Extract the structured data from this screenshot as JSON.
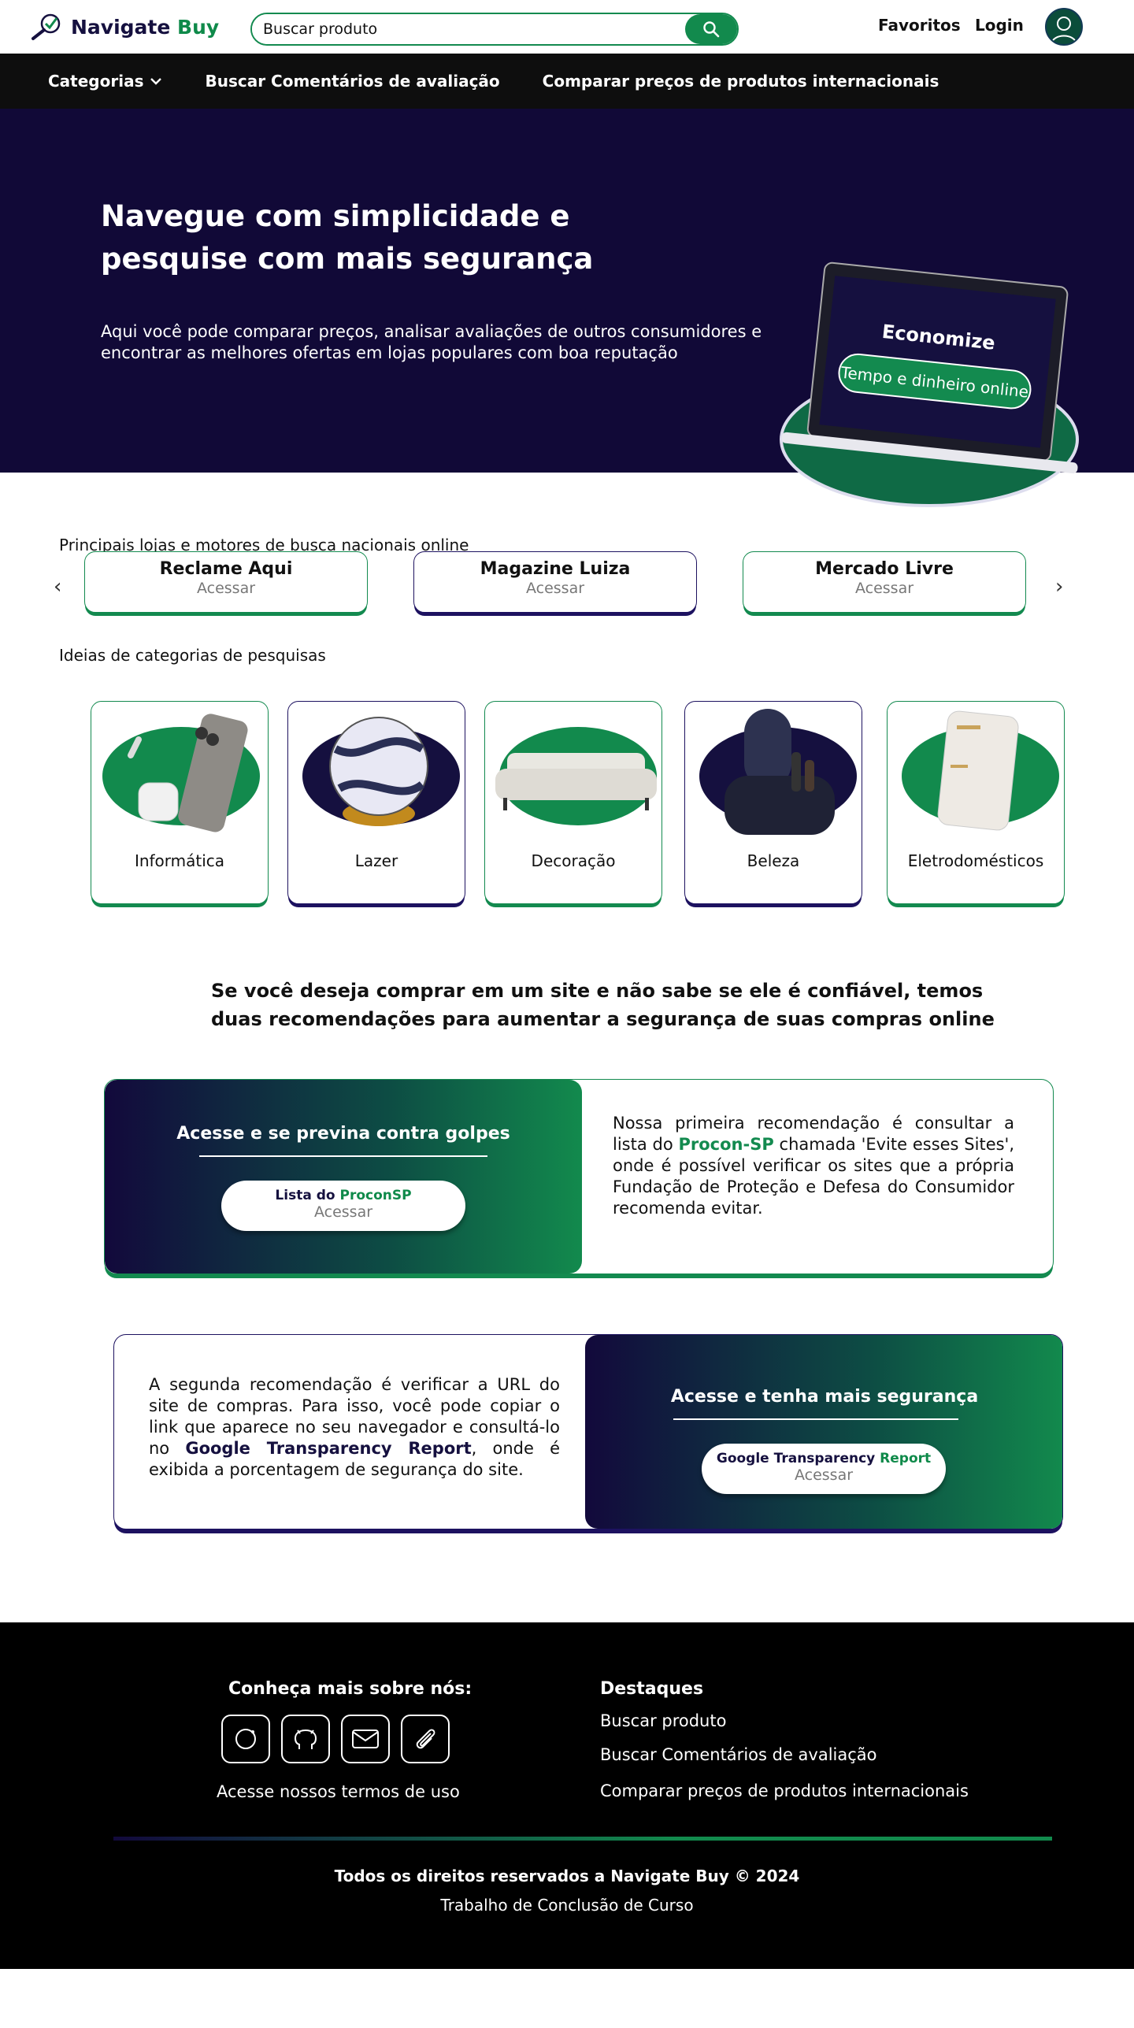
{
  "header": {
    "brand_a": "Navigate ",
    "brand_b": "Buy",
    "search_placeholder": "Buscar produto",
    "favorites": "Favoritos",
    "login": "Login"
  },
  "nav": {
    "categories": "Categorias",
    "reviews": "Buscar Comentários de avaliação",
    "compare": "Comparar preços de produtos internacionais"
  },
  "hero": {
    "title": "Navegue com simplicidade e pesquise com mais segurança",
    "subtitle": "Aqui você pode comparar preços, analisar avaliações de outros consumidores e encontrar as melhores ofertas em lojas populares com boa reputação",
    "screen_title": "Economize",
    "screen_badge": "Tempo e dinheiro online"
  },
  "stores": {
    "title": "Principais lojas e motores de busca nacionais online",
    "items": [
      {
        "name": "Reclame Aqui",
        "action": "Acessar"
      },
      {
        "name": "Magazine Luiza",
        "action": "Acessar"
      },
      {
        "name": "Mercado Livre",
        "action": "Acessar"
      }
    ]
  },
  "categories": {
    "title": "Ideias de categorias de pesquisas",
    "items": [
      {
        "label": "Informática"
      },
      {
        "label": "Lazer"
      },
      {
        "label": "Decoração"
      },
      {
        "label": "Beleza"
      },
      {
        "label": "Eletrodomésticos"
      }
    ]
  },
  "recommend": {
    "title": "Se você deseja comprar em um site e não sabe se ele é confiável, temos duas recomendações para aumentar a segurança de suas compras online",
    "card1": {
      "heading": "Acesse e se previna contra golpes",
      "btn_a": "Lista do ",
      "btn_b": "ProconSP",
      "btn_action": "Acessar",
      "text_a": "Nossa primeira recomendação é consultar a lista do ",
      "text_hl": "Procon-SP",
      "text_b": " chamada 'Evite esses Sites', onde é possível verificar os sites que a própria Fundação de Proteção e Defesa do Consumidor recomenda evitar."
    },
    "card2": {
      "heading": "Acesse e tenha mais segurança",
      "btn_a": "Google Transparency ",
      "btn_b": "Report",
      "btn_action": "Acessar",
      "text_a": "A segunda recomendação é verificar a URL do site de compras. Para isso, você pode copiar o link que aparece no seu navegador e consultá-lo no ",
      "text_hl": "Google Transparency Report",
      "text_b": ", onde é exibida a porcentagem de segurança do site."
    }
  },
  "footer": {
    "about_title": "Conheça mais sobre nós:",
    "terms": "Acesse nossos termos de uso",
    "highlights_title": "Destaques",
    "highlights": [
      "Buscar produto",
      "Buscar Comentários de avaliação",
      "Comparar preços de produtos internacionais"
    ],
    "rights": "Todos os direitos reservados a Navigate Buy © 2024",
    "tcc": "Trabalho de Conclusão de Curso"
  },
  "colors": {
    "green": "#128a4d",
    "navy": "#110937",
    "black": "#0e0e0e"
  },
  "icons": [
    "logo-check-icon",
    "search-icon",
    "user-icon",
    "chevron-down-icon",
    "chevron-left-icon",
    "chevron-right-icon",
    "instagram-icon",
    "github-icon",
    "mail-icon",
    "paperclip-icon"
  ]
}
